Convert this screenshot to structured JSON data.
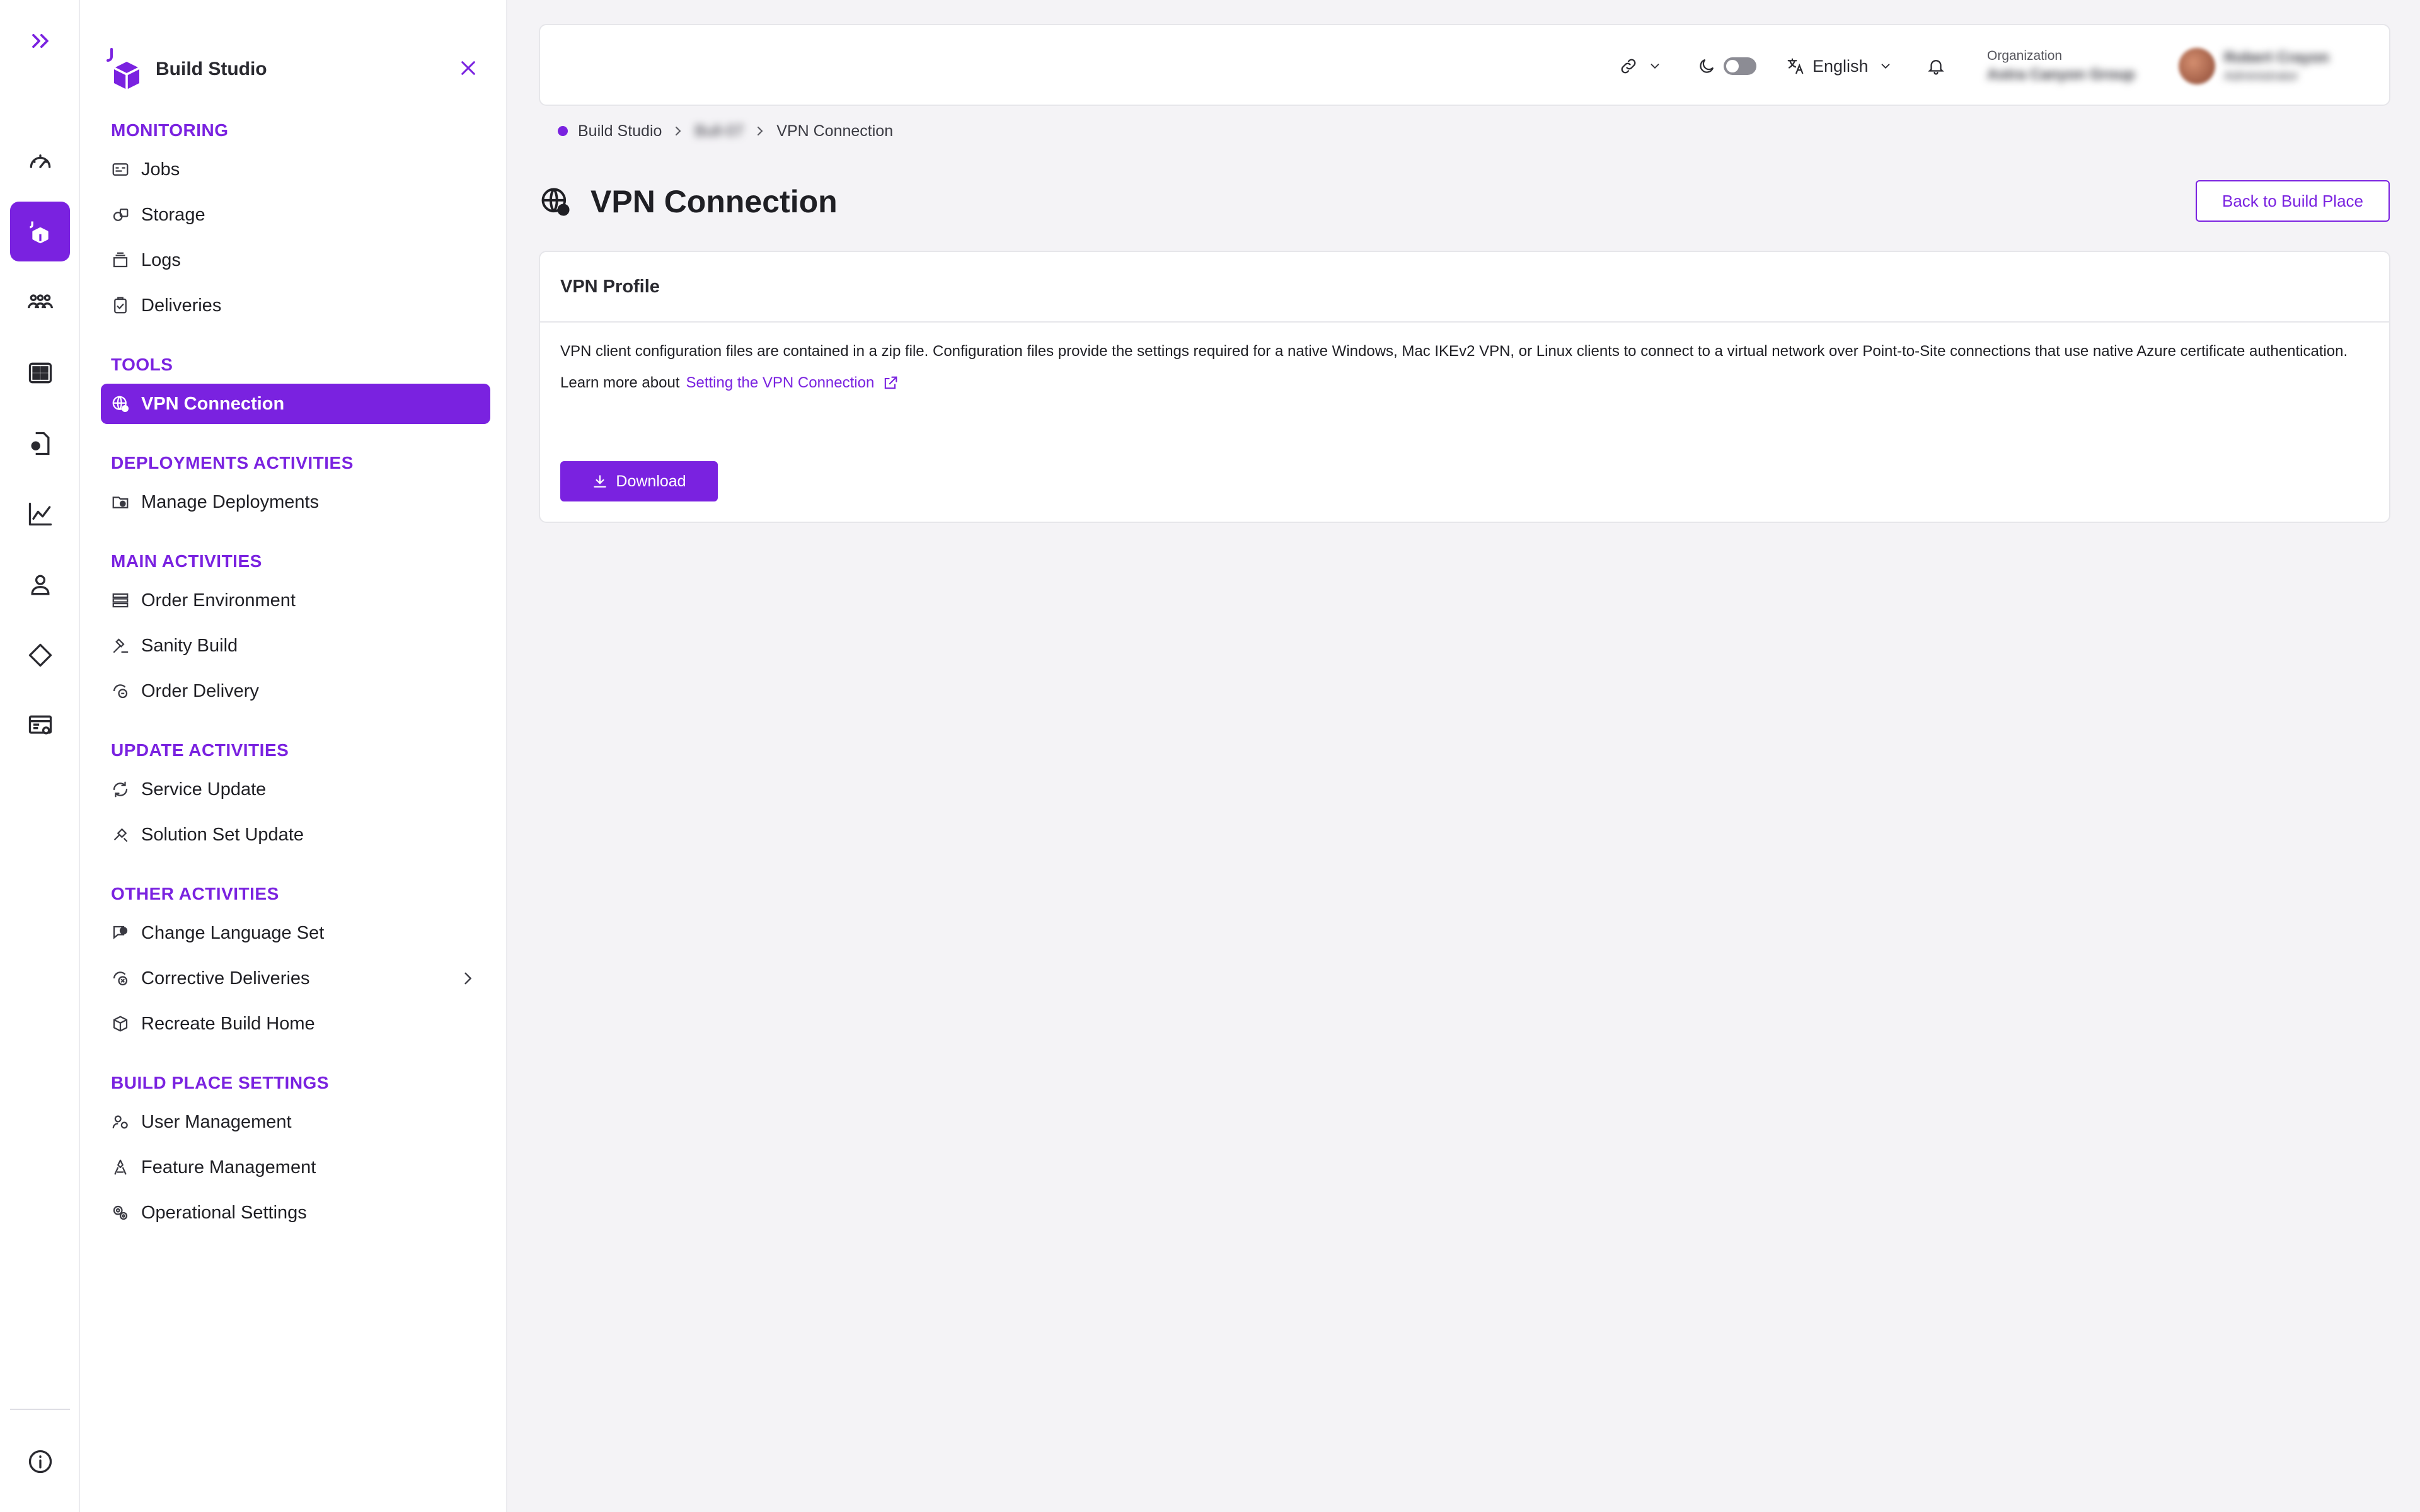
{
  "brand": {
    "name": "Build Studio"
  },
  "rail": [
    {
      "icon": "speedometer-icon"
    },
    {
      "icon": "build-studio-icon",
      "active": true
    },
    {
      "icon": "users-icon"
    },
    {
      "icon": "dashboard-grid-icon"
    },
    {
      "icon": "document-user-icon"
    },
    {
      "icon": "analytics-chart-icon"
    },
    {
      "icon": "person-icon"
    },
    {
      "icon": "diamond-icon"
    },
    {
      "icon": "settings-panel-icon"
    },
    {
      "icon": "info-icon"
    }
  ],
  "sidebar": {
    "sections": [
      {
        "title": "MONITORING",
        "items": [
          {
            "label": "Jobs",
            "icon": "jobs-icon"
          },
          {
            "label": "Storage",
            "icon": "storage-icon"
          },
          {
            "label": "Logs",
            "icon": "logs-icon"
          },
          {
            "label": "Deliveries",
            "icon": "deliveries-icon"
          }
        ]
      },
      {
        "title": "TOOLS",
        "items": [
          {
            "label": "VPN Connection",
            "icon": "vpn-globe-icon",
            "active": true
          }
        ]
      },
      {
        "title": "DEPLOYMENTS ACTIVITIES",
        "items": [
          {
            "label": "Manage Deployments",
            "icon": "manage-deployments-icon"
          }
        ]
      },
      {
        "title": "MAIN ACTIVITIES",
        "items": [
          {
            "label": "Order Environment",
            "icon": "order-environment-icon"
          },
          {
            "label": "Sanity Build",
            "icon": "sanity-build-icon"
          },
          {
            "label": "Order Delivery",
            "icon": "order-delivery-icon"
          }
        ]
      },
      {
        "title": "UPDATE ACTIVITIES",
        "items": [
          {
            "label": "Service Update",
            "icon": "service-update-icon"
          },
          {
            "label": "Solution Set Update",
            "icon": "solution-set-update-icon"
          }
        ]
      },
      {
        "title": "OTHER ACTIVITIES",
        "items": [
          {
            "label": "Change Language Set",
            "icon": "change-language-icon"
          },
          {
            "label": "Corrective Deliveries",
            "icon": "corrective-deliveries-icon",
            "has_children": true
          },
          {
            "label": "Recreate Build Home",
            "icon": "recreate-build-home-icon"
          }
        ]
      },
      {
        "title": "BUILD PLACE SETTINGS",
        "items": [
          {
            "label": "User Management",
            "icon": "user-management-icon"
          },
          {
            "label": "Feature Management",
            "icon": "feature-management-icon"
          },
          {
            "label": "Operational Settings",
            "icon": "operational-settings-icon"
          }
        ]
      }
    ]
  },
  "header": {
    "language": "English",
    "org_label": "Organization",
    "org_name": "Astra Canyon Group",
    "user_name": "Robert Crayon",
    "user_role": "Administrator"
  },
  "breadcrumb": {
    "root": "Build Studio",
    "middle": "Bull-07",
    "current": "VPN Connection"
  },
  "page": {
    "title": "VPN Connection",
    "back_label": "Back to Build Place"
  },
  "card": {
    "title": "VPN Profile",
    "description": "VPN client configuration files are contained in a zip file. Configuration files provide the settings required for a native Windows, Mac IKEv2 VPN, or Linux clients to connect to a virtual network over Point-to-Site connections that use native Azure certificate authentication.",
    "learn_prefix": "Learn more about",
    "learn_link": "Setting the VPN Connection",
    "download_label": "Download"
  },
  "colors": {
    "accent": "#7a22e0",
    "background": "#f4f3f6"
  }
}
